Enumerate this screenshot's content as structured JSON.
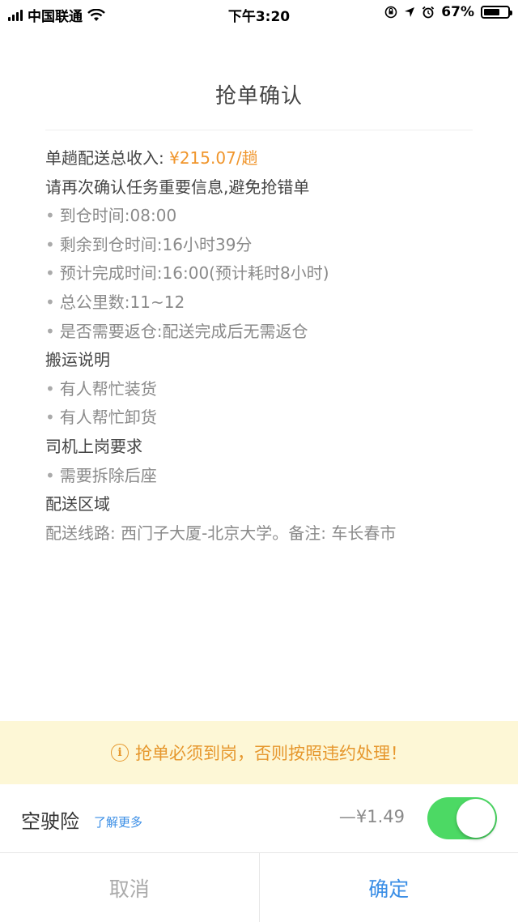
{
  "status_bar": {
    "carrier": "中国联通",
    "time": "下午3:20",
    "battery_percent_text": "67%",
    "battery_level": 0.67
  },
  "dialog": {
    "title": "抢单确认",
    "income_label": "单趟配送总收入: ",
    "income_value": "¥215.07/趟",
    "confirm_note": "请再次确认任务重要信息,避免抢错单",
    "task_info": [
      "到仓时间:08:00",
      "剩余到仓时间:16小时39分",
      "预计完成时间:16:00(预计耗时8小时)",
      "总公里数:11~12",
      "是否需要返仓:配送完成后无需返仓"
    ],
    "handling_heading": "搬运说明",
    "handling_items": [
      "有人帮忙装货",
      "有人帮忙卸货"
    ],
    "driver_heading": "司机上岗要求",
    "driver_items": [
      "需要拆除后座"
    ],
    "area_heading": "配送区域",
    "area_text": "配送线路: 西门子大厦-北京大学。备注: 车长春市"
  },
  "notice": {
    "icon": "info-circle-icon",
    "text": "抢单必须到岗，否则按照违约处理！"
  },
  "insurance": {
    "label": "空驶险",
    "link": "了解更多",
    "price": "—¥1.49",
    "enabled": true
  },
  "buttons": {
    "cancel": "取消",
    "confirm": "确定"
  },
  "colors": {
    "accent_blue": "#3a8ee6",
    "orange": "#f0952b",
    "toggle_on": "#4cd964",
    "notice_bg": "#fdf7d6"
  }
}
